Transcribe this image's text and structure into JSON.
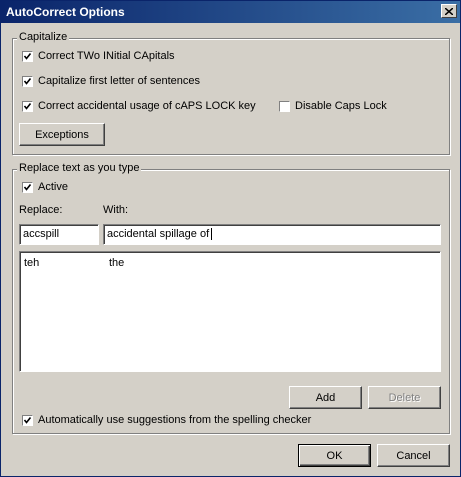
{
  "window": {
    "title": "AutoCorrect Options"
  },
  "capitalize": {
    "legend": "Capitalize",
    "options": [
      {
        "label": "Correct TWo INitial CApitals",
        "checked": true
      },
      {
        "label": "Capitalize first letter of sentences",
        "checked": true
      },
      {
        "label": "Correct accidental usage of cAPS LOCK key",
        "checked": true
      }
    ],
    "disable_caps": {
      "label": "Disable Caps Lock",
      "checked": false
    },
    "exceptions_label": "Exceptions"
  },
  "replace": {
    "legend": "Replace text as you type",
    "active": {
      "label": "Active",
      "checked": true
    },
    "replace_label": "Replace:",
    "with_label": "With:",
    "replace_value": "accspill",
    "with_value": "accidental spillage of",
    "rows": [
      {
        "replace": "teh",
        "with": "the"
      }
    ],
    "add_label": "Add",
    "delete_label": "Delete",
    "suggestions": {
      "label": "Automatically use suggestions from the spelling checker",
      "checked": true
    }
  },
  "footer": {
    "ok_label": "OK",
    "cancel_label": "Cancel"
  }
}
